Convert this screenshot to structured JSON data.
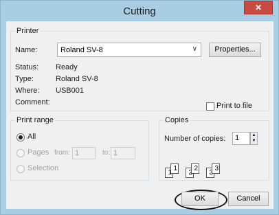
{
  "window": {
    "title": "Cutting",
    "close_glyph": "✕"
  },
  "printer": {
    "legend": "Printer",
    "name_label": "Name:",
    "name_value": "Roland SV-8",
    "properties_button": "Properties...",
    "status_label": "Status:",
    "status_value": "Ready",
    "type_label": "Type:",
    "type_value": "Roland SV-8",
    "where_label": "Where:",
    "where_value": "USB001",
    "comment_label": "Comment:",
    "print_to_file": "Print to file"
  },
  "print_range": {
    "legend": "Print range",
    "all": "All",
    "pages": "Pages",
    "from_label": "from:",
    "from_value": "1",
    "to_label": "to:",
    "to_value": "1",
    "selection": "Selection"
  },
  "copies": {
    "legend": "Copies",
    "number_label": "Number of copies:",
    "number_value": "1",
    "collate_pages": [
      "1",
      "1",
      "2",
      "2",
      "3",
      "3"
    ]
  },
  "buttons": {
    "ok": "OK",
    "cancel": "Cancel"
  },
  "colors": {
    "title_bar": "#a9cde2",
    "close_button": "#c74b40",
    "dialog_body": "#f0f0f0"
  }
}
